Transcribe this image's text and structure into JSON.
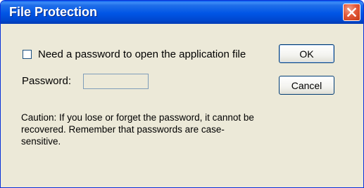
{
  "window": {
    "title": "File Protection",
    "close_icon": "close-icon"
  },
  "form": {
    "checkbox_label": "Need a password to open the application file",
    "checkbox_checked": false,
    "password_label": "Password:",
    "password_value": ""
  },
  "caution_text": "Caution: If you lose or forget the password, it cannot be recovered. Remember that passwords are case-sensitive.",
  "buttons": {
    "ok_label": "OK",
    "cancel_label": "Cancel"
  },
  "colors": {
    "titlebar": "#0055e5",
    "dialog_bg": "#ece9d8",
    "close_button": "#e3593a"
  }
}
